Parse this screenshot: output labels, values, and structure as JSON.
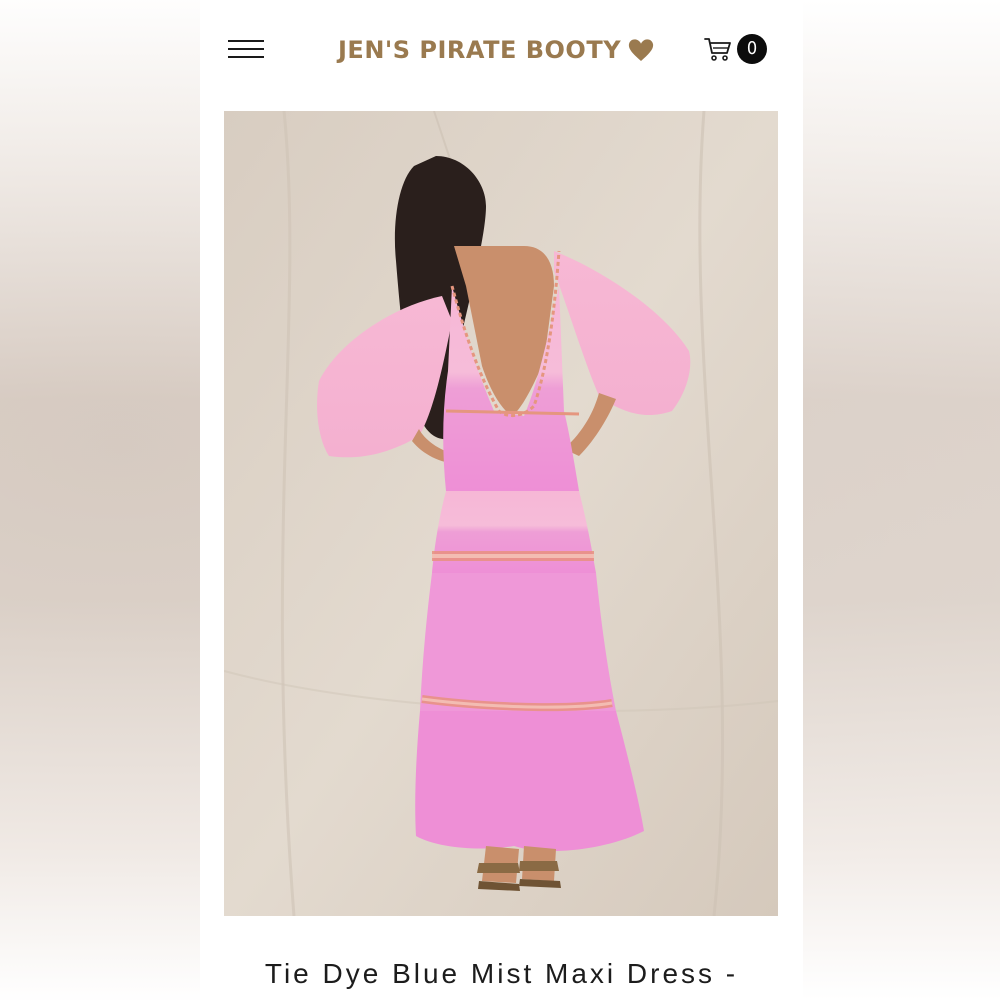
{
  "header": {
    "menu_icon": "hamburger-menu-icon",
    "logo_text": "JEN'S PIRATE BOOTY",
    "logo_icon": "heart-icon",
    "cart_icon": "shopping-cart-icon",
    "cart_count": "0"
  },
  "product": {
    "image_alt": "Model wearing pink tie dye maxi dress with open back",
    "title": "Tie Dye Blue Mist Maxi Dress -"
  },
  "colors": {
    "brand": "#9a7a4f",
    "dress_pink": "#f29ad6",
    "backdrop": "#e0d6cb",
    "badge": "#0c0c0c"
  }
}
